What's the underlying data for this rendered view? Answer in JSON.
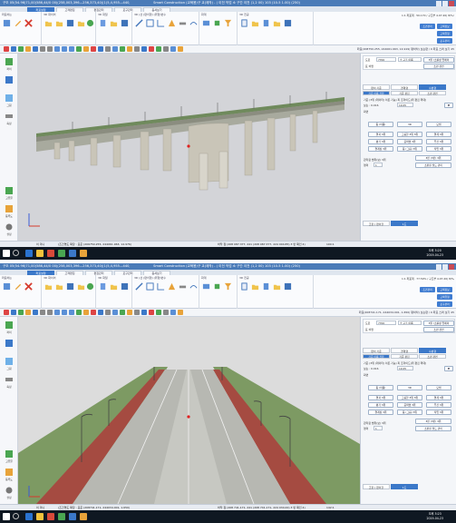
{
  "screens": [
    {
      "title_left": "구조 05(54.96)71,00(586,44/0 00)(258,003,396—256,373,40)(1(5,4,955—440,546.954)-55,409—202,00)",
      "title_center": "Smart Construction (교육용)구 교(제작) - ( 이전 작업 소 구간 이전 (1,2 00) 103 (10-5 1.00) (250)",
      "tabs": [
        "좌표설정",
        "고객편집",
        "편집관리",
        "포구관리",
        "옵셔보기"
      ],
      "active_tab": 0,
      "ribbon_groups": [
        "좌표하는",
        "3D 화이어",
        "3D 화일",
        "3D (선 (편치형) (위형)변수",
        "화계",
        "",
        "3D 전공"
      ],
      "ribbon_right_buttons": [
        "고객정보",
        "고객유형",
        "포구관리",
        "조건관리"
      ],
      "ribbon_right_text": "1:1 좌표계 · 50.170 / 구조부 4.07.20) 8/%/ 이름",
      "coord_text": "좌표(208750.255, 244061.963, 14.919) 평하차) 보는편 / 0 좌표 스와 보기 45",
      "left_tools": [
        "좌이",
        "",
        "그림",
        "",
        "측정"
      ],
      "left_tools_bottom": [
        "고유물",
        "등록도",
        "설정"
      ],
      "panel": {
        "field1": "7700",
        "label1": "도로",
        "field2": "소 구조 이름",
        "btn1": "3원 (소를성 업에이",
        "label2": "표 비앤",
        "btn2": "소편 관련",
        "tabs": [
          "편이 기준",
          "경재형",
          "수분형"
        ],
        "active_tab": 2,
        "subtabs": [
          "기준 이름 전환",
          "기준 편집",
          "소편 관련"
        ],
        "row1": "기준 (3위 (데이터) 이론 기능) 피 프라이드(위 편집 확대)",
        "row2_label": "보는 : 0.016",
        "row2_value": "10.05",
        "row3_label": "화면",
        "btn_grid": [
          "등 (이름)",
          "3D",
          "모범",
          "결과 3위",
          "그룹한 3위 3위",
          "결계 3위",
          "평가 3위",
          "공의명 3위",
          "무선 3위",
          "결계상 3위",
          "동 (그룹) 3위",
          "작업 3위"
        ],
        "section_label": "관리함 범위(보) 3위",
        "section_val": "영의",
        "section_num": "1",
        "bottom_btn1": "3번 (3번) 3위",
        "bottom_btn2": "소편된 필드 관리",
        "bottom_tabs": [
          "조합 ( 편이할",
          "1도",
          "수분"
        ]
      },
      "status": {
        "left": "이 미니",
        "mid": "(조건명도 확장 : 표준 (206750.255, 244061.963, 14.976)",
        "right": "바닥 점 (208 087.377, 241 (208 087.377, 224 004.85) 3 번 확인 4)",
        "zoom": "100:1"
      },
      "clock_time": "오후 5:20",
      "clock_date": "2019-04-23",
      "scene": "bridge"
    },
    {
      "title_left": "구조 05(54.96)71,00(586,44/0 00)(258,003,396—256,373,40)(1(5,4,955—440,546.954)-55,409—202,00)",
      "title_center": "Smart Construction (교육용)구 교(제작) - ( 이전 작업 소 구간 이전 (1,2 00) 103 (10-5 1.00) (250)",
      "tabs": [
        "좌표설정",
        "고객편집",
        "편집관리",
        "포구관리",
        "옵셔보기"
      ],
      "active_tab": 0,
      "ribbon_groups": [
        "좌표하는",
        "3D 화이어",
        "3D 화일",
        "3D (선 (편치형) (위형)변수",
        "화계",
        "",
        "3D 전공"
      ],
      "ribbon_right_buttons": [
        "고객정보",
        "고객유형",
        "포구관리",
        "조건관리"
      ],
      "ribbon_right_text": "1:1 좌표계 · 77.59% / 구조부 4.07.20) 8/%/ 이름",
      "coord_text": "좌표(208741.171, 244034.001, 1.650) 평하차) 보는편 / 0 좌표 스와 보기 45",
      "left_tools": [
        "좌이",
        "",
        "그림",
        "",
        "측정"
      ],
      "left_tools_bottom": [
        "고유물",
        "등록도",
        "설정"
      ],
      "panel": {
        "field1": "7700",
        "label1": "도로",
        "field2": "소 구조 이름",
        "btn1": "3원 (소를성 업에이",
        "label2": "표 비앤",
        "btn2": "소편 관련",
        "tabs": [
          "편이 기준",
          "경재형",
          "수분형"
        ],
        "active_tab": 2,
        "subtabs": [
          "기준 이름 전환",
          "기준 편집",
          "소편 관련"
        ],
        "row1": "기준 (3위 (데이터) 이론 기능) 피 프라이드(위 편집 확대)",
        "row2_label": "보는 : 0.016",
        "row2_value": "10.05",
        "row3_label": "화면",
        "btn_grid": [
          "등 (이름)",
          "3D",
          "모범",
          "결과 3위",
          "그룹한 3위 3위",
          "결계 3위",
          "평가 3위",
          "공의명 3위",
          "무선 3위",
          "결계상 3위",
          "동 (그룹) 3위",
          "작업 3위"
        ],
        "section_label": "관리함 범위(보) 3위",
        "section_val": "영의",
        "section_num": "1",
        "bottom_btn1": "3번 (3번) 3위",
        "bottom_btn2": "소편된 필드 관리",
        "bottom_tabs": [
          "조합 ( 편이할",
          "1도",
          "수분"
        ]
      },
      "status": {
        "left": "이 미니",
        "mid": "(조건명도 확장 : 표준 (208741.171, 244034.001, 1.650)",
        "right": "바닥 점 (208 741.171, 241 (208 741.171, 224 034.00) 3 번 확인 4)",
        "zoom": "142:1"
      },
      "clock_time": "오후 5:23",
      "clock_date": "2019-04-23",
      "scene": "road"
    }
  ],
  "colors": {
    "accent": "#3b78c9",
    "taskbar": "#0f1822",
    "title": "#4a7bb8"
  }
}
